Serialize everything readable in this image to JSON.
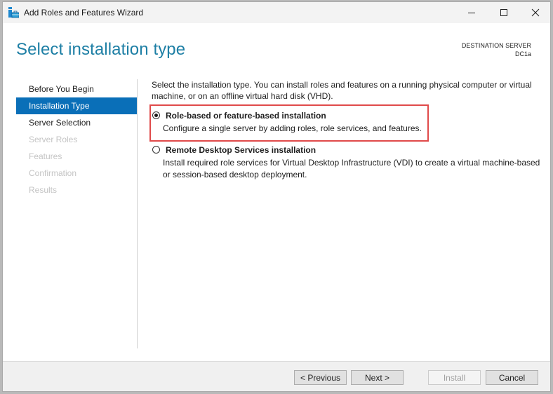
{
  "window": {
    "title": "Add Roles and Features Wizard",
    "controls": {
      "minimize": "minimize",
      "maximize": "maximize",
      "close": "close"
    }
  },
  "header": {
    "page_title": "Select installation type",
    "destination_label": "DESTINATION SERVER",
    "destination_value": "DC1a"
  },
  "nav": {
    "items": [
      {
        "label": "Before You Begin",
        "state": "enabled"
      },
      {
        "label": "Installation Type",
        "state": "active"
      },
      {
        "label": "Server Selection",
        "state": "enabled"
      },
      {
        "label": "Server Roles",
        "state": "disabled"
      },
      {
        "label": "Features",
        "state": "disabled"
      },
      {
        "label": "Confirmation",
        "state": "disabled"
      },
      {
        "label": "Results",
        "state": "disabled"
      }
    ]
  },
  "main": {
    "intro": "Select the installation type. You can install roles and features on a running physical computer or virtual machine, or on an offline virtual hard disk (VHD).",
    "options": [
      {
        "title": "Role-based or feature-based installation",
        "description": "Configure a single server by adding roles, role services, and features.",
        "selected": true,
        "highlighted": true
      },
      {
        "title": "Remote Desktop Services installation",
        "description": "Install required role services for Virtual Desktop Infrastructure (VDI) to create a virtual machine-based or session-based desktop deployment.",
        "selected": false,
        "highlighted": false
      }
    ],
    "highlight_color": "#e04a4a",
    "accent_color": "#0a6fb8",
    "title_color": "#1e7fa5"
  },
  "footer": {
    "previous_label": "< Previous",
    "next_label": "Next >",
    "install_label": "Install",
    "install_disabled": true,
    "cancel_label": "Cancel"
  }
}
